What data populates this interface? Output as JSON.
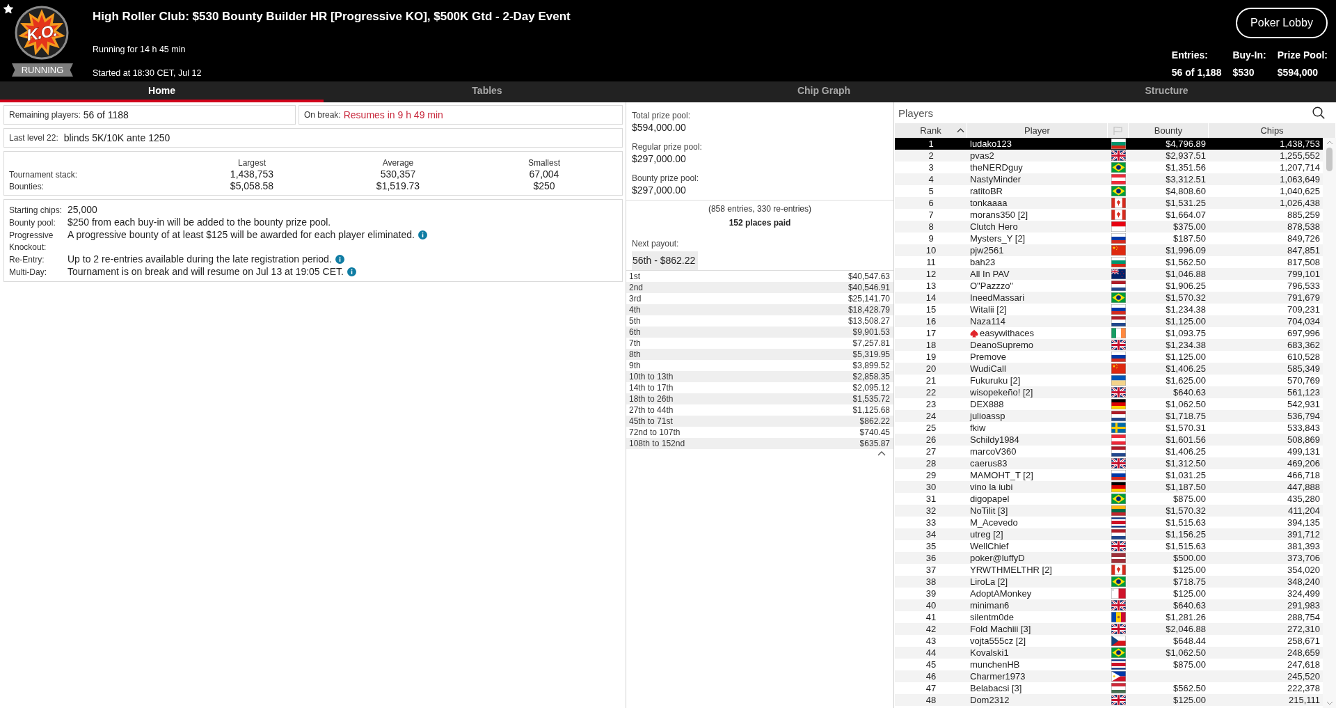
{
  "header": {
    "starred": true,
    "logo_text": "K.O.",
    "status": "RUNNING",
    "title": "High Roller Club: $530 Bounty Builder HR [Progressive KO], $500K Gtd - 2-Day Event",
    "running_for": "Running for 14 h 45 min",
    "started_at": "Started at 18:30 CET, Jul 12",
    "lobby_button": "Poker Lobby",
    "stats": [
      {
        "label": "Entries:",
        "value": "56 of 1,188"
      },
      {
        "label": "Buy-In:",
        "value": "$530"
      },
      {
        "label": "Prize Pool:",
        "value": "$594,000"
      }
    ]
  },
  "tabs": [
    {
      "label": "Home",
      "selected": true
    },
    {
      "label": "Tables",
      "selected": false
    },
    {
      "label": "Chip Graph",
      "selected": false
    },
    {
      "label": "Structure",
      "selected": false
    }
  ],
  "summary": {
    "remaining": {
      "label": "Remaining players:",
      "value": "56 of 1188"
    },
    "break": {
      "label": "On break:",
      "value": "Resumes in 9 h 49 min"
    },
    "last_level": {
      "label": "Last level 22:",
      "value": "blinds 5K/10K ante 1250"
    }
  },
  "stacks": {
    "columns": [
      "Largest",
      "Average",
      "Smallest"
    ],
    "rows": [
      {
        "label": "Tournament stack:",
        "values": [
          "1,438,753",
          "530,357",
          "67,004"
        ]
      },
      {
        "label": "Bounties:",
        "values": [
          "$5,058.58",
          "$1,519.73",
          "$250"
        ]
      }
    ]
  },
  "details": [
    {
      "label": "Starting chips:",
      "value": "25,000",
      "info": false
    },
    {
      "label": "Bounty pool:",
      "value": "$250 from each buy-in will be added to the bounty prize pool.",
      "info": false
    },
    {
      "label": "Progressive Knockout:",
      "value": "A progressive bounty of at least $125 will be awarded for each player eliminated.",
      "info": true
    },
    {
      "label": "Re-Entry:",
      "value": "Up to 2 re-entries available during the late registration period.",
      "info": true
    },
    {
      "label": "Multi-Day:",
      "value": "Tournament is on break and will resume on Jul 13 at 19:05 CET.",
      "info": true
    }
  ],
  "prize": {
    "pools": [
      {
        "label": "Total prize pool:",
        "value": "$594,000.00"
      },
      {
        "label": "Regular prize pool:",
        "value": "$297,000.00"
      },
      {
        "label": "Bounty prize pool:",
        "value": "$297,000.00"
      }
    ],
    "entries_note": "(858 entries, 330 re-entries)",
    "places_paid": "152 places paid",
    "next_payout": {
      "label": "Next payout:",
      "value": "56th - $862.22"
    },
    "payouts": [
      {
        "place": "1st",
        "amount": "$40,547.63"
      },
      {
        "place": "2nd",
        "amount": "$40,546.91"
      },
      {
        "place": "3rd",
        "amount": "$25,141.70"
      },
      {
        "place": "4th",
        "amount": "$18,428.79"
      },
      {
        "place": "5th",
        "amount": "$13,508.27"
      },
      {
        "place": "6th",
        "amount": "$9,901.53"
      },
      {
        "place": "7th",
        "amount": "$7,257.81"
      },
      {
        "place": "8th",
        "amount": "$5,319.95"
      },
      {
        "place": "9th",
        "amount": "$3,899.52"
      },
      {
        "place": "10th to 13th",
        "amount": "$2,858.35"
      },
      {
        "place": "14th to 17th",
        "amount": "$2,095.12"
      },
      {
        "place": "18th to 26th",
        "amount": "$1,535.72"
      },
      {
        "place": "27th to 44th",
        "amount": "$1,125.68"
      },
      {
        "place": "45th to 71st",
        "amount": "$862.22"
      },
      {
        "place": "72nd to 107th",
        "amount": "$740.45"
      },
      {
        "place": "108th to 152nd",
        "amount": "$635.87"
      }
    ]
  },
  "players": {
    "title": "Players",
    "columns": [
      {
        "kind": "text",
        "label": "Rank",
        "sorted": true
      },
      {
        "kind": "text",
        "label": "Player",
        "sorted": false
      },
      {
        "kind": "flag",
        "sorted": false
      },
      {
        "kind": "text",
        "label": "Bounty",
        "sorted": false
      },
      {
        "kind": "text",
        "label": "Chips",
        "sorted": false
      }
    ],
    "rows": [
      {
        "rank": "1",
        "player": "ludako123",
        "kind": "bulgaria",
        "bounty": "$4,796.89",
        "chips": "1,438,753",
        "selected": true,
        "spade_icon": false
      },
      {
        "rank": "2",
        "player": "pvas2",
        "kind": "britain",
        "bounty": "$2,937.51",
        "chips": "1,255,552",
        "selected": false,
        "spade_icon": false
      },
      {
        "rank": "3",
        "player": "theNERDguy",
        "kind": "brazil",
        "bounty": "$1,351.56",
        "chips": "1,207,714",
        "selected": false,
        "spade_icon": false
      },
      {
        "rank": "4",
        "player": "NastyMinder",
        "kind": "austria",
        "bounty": "$3,312.51",
        "chips": "1,063,649",
        "selected": false,
        "spade_icon": false
      },
      {
        "rank": "5",
        "player": "ratitoBR",
        "kind": "brazil",
        "bounty": "$4,808.60",
        "chips": "1,040,625",
        "selected": false,
        "spade_icon": false
      },
      {
        "rank": "6",
        "player": "tonkaaaa",
        "kind": "canada",
        "bounty": "$1,531.25",
        "chips": "1,026,438",
        "selected": false,
        "spade_icon": false
      },
      {
        "rank": "7",
        "player": "morans350 [2]",
        "kind": "canada",
        "bounty": "$1,664.07",
        "chips": "885,259",
        "selected": false,
        "spade_icon": false
      },
      {
        "rank": "8",
        "player": "Clutch Hero",
        "kind": "indonesia",
        "bounty": "$375.00",
        "chips": "878,538",
        "selected": false,
        "spade_icon": false
      },
      {
        "rank": "9",
        "player": "Mysters_Y [2]",
        "kind": "russia",
        "bounty": "$187.50",
        "chips": "849,726",
        "selected": false,
        "spade_icon": false
      },
      {
        "rank": "10",
        "player": "pjw2561",
        "kind": "china",
        "bounty": "$1,996.09",
        "chips": "847,851",
        "selected": false,
        "spade_icon": false
      },
      {
        "rank": "11",
        "player": "bah23",
        "kind": "bulgaria",
        "bounty": "$1,562.50",
        "chips": "817,508",
        "selected": false,
        "spade_icon": false
      },
      {
        "rank": "12",
        "player": "All In PAV",
        "kind": "newzealand",
        "bounty": "$1,046.88",
        "chips": "799,101",
        "selected": false,
        "spade_icon": false
      },
      {
        "rank": "13",
        "player": "O\"Pazzzo\"",
        "kind": "netherlands",
        "bounty": "$1,906.25",
        "chips": "796,533",
        "selected": false,
        "spade_icon": false
      },
      {
        "rank": "14",
        "player": "IneedMassari",
        "kind": "brazil",
        "bounty": "$1,570.32",
        "chips": "791,679",
        "selected": false,
        "spade_icon": false
      },
      {
        "rank": "15",
        "player": "Witalii [2]",
        "kind": "russia",
        "bounty": "$1,234.38",
        "chips": "709,231",
        "selected": false,
        "spade_icon": false
      },
      {
        "rank": "16",
        "player": "Naza114",
        "kind": "netherlands",
        "bounty": "$1,125.00",
        "chips": "704,034",
        "selected": false,
        "spade_icon": false
      },
      {
        "rank": "17",
        "player": "easywithaces",
        "kind": "ireland",
        "bounty": "$1,093.75",
        "chips": "697,996",
        "selected": false,
        "spade_icon": true
      },
      {
        "rank": "18",
        "player": "DeanoSupremo",
        "kind": "britain",
        "bounty": "$1,234.38",
        "chips": "683,362",
        "selected": false,
        "spade_icon": false
      },
      {
        "rank": "19",
        "player": "Premove",
        "kind": "russia",
        "bounty": "$1,125.00",
        "chips": "610,528",
        "selected": false,
        "spade_icon": false
      },
      {
        "rank": "20",
        "player": "WudiCall",
        "kind": "china",
        "bounty": "$1,406.25",
        "chips": "585,349",
        "selected": false,
        "spade_icon": false
      },
      {
        "rank": "21",
        "player": "Fukuruku [2]",
        "kind": "ukraine",
        "bounty": "$1,625.00",
        "chips": "570,769",
        "selected": false,
        "spade_icon": false
      },
      {
        "rank": "22",
        "player": "wisopekeño! [2]",
        "kind": "britain",
        "bounty": "$640.63",
        "chips": "561,123",
        "selected": false,
        "spade_icon": false
      },
      {
        "rank": "23",
        "player": "DEX888",
        "kind": "germany",
        "bounty": "$1,062.50",
        "chips": "542,931",
        "selected": false,
        "spade_icon": false
      },
      {
        "rank": "24",
        "player": "julioassp",
        "kind": "netherlands",
        "bounty": "$1,718.75",
        "chips": "536,794",
        "selected": false,
        "spade_icon": false
      },
      {
        "rank": "25",
        "player": "fkiw",
        "kind": "sweden",
        "bounty": "$1,570.31",
        "chips": "533,843",
        "selected": false,
        "spade_icon": false
      },
      {
        "rank": "26",
        "player": "Schildy1984",
        "kind": "austria",
        "bounty": "$1,601.56",
        "chips": "508,869",
        "selected": false,
        "spade_icon": false
      },
      {
        "rank": "27",
        "player": "marcoV360",
        "kind": "netherlands",
        "bounty": "$1,406.25",
        "chips": "499,131",
        "selected": false,
        "spade_icon": false
      },
      {
        "rank": "28",
        "player": "caerus83",
        "kind": "britain",
        "bounty": "$1,312.50",
        "chips": "469,206",
        "selected": false,
        "spade_icon": false
      },
      {
        "rank": "29",
        "player": "MAMOHT_T [2]",
        "kind": "russia",
        "bounty": "$1,031.25",
        "chips": "466,718",
        "selected": false,
        "spade_icon": false
      },
      {
        "rank": "30",
        "player": "vino la iubi",
        "kind": "germany",
        "bounty": "$1,187.50",
        "chips": "447,888",
        "selected": false,
        "spade_icon": false
      },
      {
        "rank": "31",
        "player": "digopapel",
        "kind": "brazil",
        "bounty": "$875.00",
        "chips": "435,280",
        "selected": false,
        "spade_icon": false
      },
      {
        "rank": "32",
        "player": "NoTilit [3]",
        "kind": "lithuania",
        "bounty": "$1,570.32",
        "chips": "411,204",
        "selected": false,
        "spade_icon": false
      },
      {
        "rank": "33",
        "player": "M_Acevedo",
        "kind": "costarica",
        "bounty": "$1,515.63",
        "chips": "394,135",
        "selected": false,
        "spade_icon": false
      },
      {
        "rank": "34",
        "player": "utreg [2]",
        "kind": "netherlands",
        "bounty": "$1,156.25",
        "chips": "391,712",
        "selected": false,
        "spade_icon": false
      },
      {
        "rank": "35",
        "player": "WellChief",
        "kind": "britain",
        "bounty": "$1,515.63",
        "chips": "381,393",
        "selected": false,
        "spade_icon": false
      },
      {
        "rank": "36",
        "player": "poker@luffyD",
        "kind": "latvia",
        "bounty": "$500.00",
        "chips": "373,706",
        "selected": false,
        "spade_icon": false
      },
      {
        "rank": "37",
        "player": "YRWTHMELTHR [2]",
        "kind": "canada",
        "bounty": "$125.00",
        "chips": "354,020",
        "selected": false,
        "spade_icon": false
      },
      {
        "rank": "38",
        "player": "LiroLa [2]",
        "kind": "brazil",
        "bounty": "$718.75",
        "chips": "348,240",
        "selected": false,
        "spade_icon": false
      },
      {
        "rank": "39",
        "player": "AdoptAMonkey",
        "kind": "malta",
        "bounty": "$125.00",
        "chips": "324,499",
        "selected": false,
        "spade_icon": false
      },
      {
        "rank": "40",
        "player": "miniman6",
        "kind": "britain",
        "bounty": "$640.63",
        "chips": "291,983",
        "selected": false,
        "spade_icon": false
      },
      {
        "rank": "41",
        "player": "silentm0de",
        "kind": "moldova",
        "bounty": "$1,281.26",
        "chips": "288,754",
        "selected": false,
        "spade_icon": false
      },
      {
        "rank": "42",
        "player": "Fold Machiii [3]",
        "kind": "britain",
        "bounty": "$2,046.88",
        "chips": "272,310",
        "selected": false,
        "spade_icon": false
      },
      {
        "rank": "43",
        "player": "vojta555cz [2]",
        "kind": "czechia",
        "bounty": "$648.44",
        "chips": "258,671",
        "selected": false,
        "spade_icon": false
      },
      {
        "rank": "44",
        "player": "Kovalski1",
        "kind": "brazil",
        "bounty": "$1,062.50",
        "chips": "248,659",
        "selected": false,
        "spade_icon": false
      },
      {
        "rank": "45",
        "player": "munchenHB",
        "kind": "costarica",
        "bounty": "$875.00",
        "chips": "247,618",
        "selected": false,
        "spade_icon": false
      },
      {
        "rank": "46",
        "player": "Charmer1973",
        "kind": "philippines",
        "chips": "245,520",
        "selected": false,
        "spade_icon": false
      },
      {
        "rank": "47",
        "player": "Belabacsi [3]",
        "kind": "hungary",
        "bounty": "$562.50",
        "chips": "222,378",
        "selected": false,
        "spade_icon": false
      },
      {
        "rank": "48",
        "player": "Dom2312",
        "kind": "britain",
        "bounty": "$125.00",
        "chips": "215,111",
        "selected": false,
        "spade_icon": false
      }
    ]
  }
}
